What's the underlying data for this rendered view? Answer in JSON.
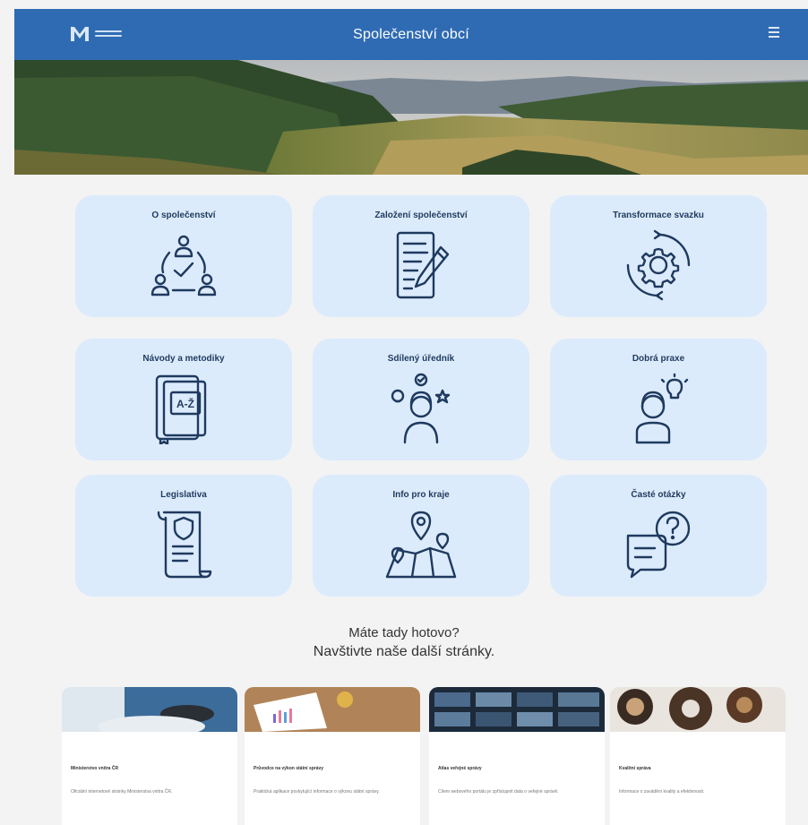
{
  "header": {
    "site_title": "Společenství obcí",
    "logo": "ministry-logo",
    "menu_icon": "hamburger-icon"
  },
  "hero": {
    "description_icon": "landscape-photo"
  },
  "tiles": [
    {
      "label": "O společenství",
      "icon": "people-network-icon"
    },
    {
      "label": "Založení společenství",
      "icon": "document-pen-icon"
    },
    {
      "label": "Transformace svazku",
      "icon": "gear-cycle-icon"
    },
    {
      "label": "Návody a metodiky",
      "icon": "book-az-icon"
    },
    {
      "label": "Sdílený úředník",
      "icon": "officer-ideas-icon"
    },
    {
      "label": "Dobrá praxe",
      "icon": "person-lightbulb-icon"
    },
    {
      "label": "Legislativa",
      "icon": "scroll-law-icon"
    },
    {
      "label": "Info pro kraje",
      "icon": "map-pins-icon"
    },
    {
      "label": "Časté otázky",
      "icon": "chat-question-icon"
    }
  ],
  "cta": {
    "line1": "Máte tady hotovo?",
    "line2": "Navštivte naše další stránky."
  },
  "cards": [
    {
      "title": "Ministerstvo vnitra ČR",
      "description": "Oficiální internetové stránky Ministerstva vnitra ČR."
    },
    {
      "title": "Průvodce na výkon státní správy",
      "description": "Praktická aplikace poskytující informace o výkonu státní správy."
    },
    {
      "title": "Atlas veřejné správy",
      "description": "Cílem webového portálu je zpřístupnit data o veřejné správě."
    },
    {
      "title": "Kvalitní správa",
      "description": "Informace o zavádění kvality a efektivnosti."
    }
  ],
  "colors": {
    "header": "#2f6bb3",
    "tile_bg": "#dcebfb",
    "icon": "#1f3a5f",
    "page_bg": "#f3f3f3"
  }
}
